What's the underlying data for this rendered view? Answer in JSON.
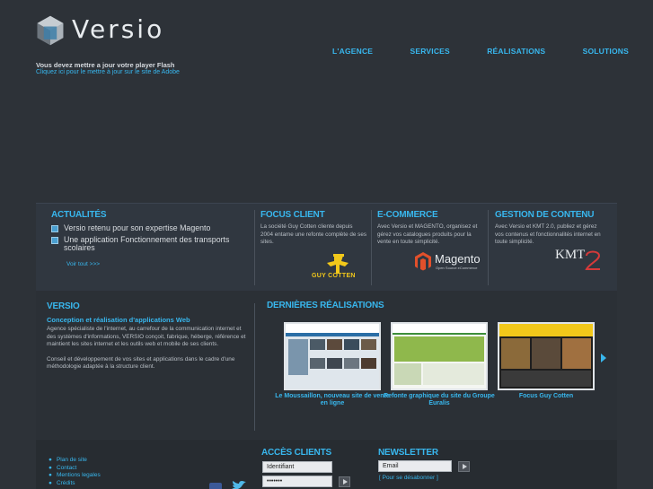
{
  "brand": {
    "name": "Versio"
  },
  "nav": [
    "L'AGENCE",
    "SERVICES",
    "RÉALISATIONS",
    "SOLUTIONS"
  ],
  "flash": {
    "title": "Vous devez mettre a jour votre player Flash",
    "link": "Cliquez ici pour le mettre à jour sur le site de Adobe"
  },
  "actualites": {
    "title": "ACTUALITÉS",
    "items": [
      "Versio retenu pour son expertise Magento",
      "Une application Fonctionnement des transports scolaires"
    ],
    "more": "Voir tout >>>"
  },
  "focus": {
    "title": "FOCUS CLIENT",
    "text": "La société Guy Cotten cliente depuis 2004 entame une refonte complète de ses sites.",
    "logo": "GUY COTTEN"
  },
  "ecommerce": {
    "title": "E-COMMERCE",
    "text": "Avec Versio et MAGENTO, organisez et gérez vos catalogues produits pour la vente en toute simplicité.",
    "logo": "Magento",
    "logo_sub": "Open Source eCommerce"
  },
  "gestion": {
    "title": "GESTION DE CONTENU",
    "text": "Avec Versio et KMT 2.0, publiez et gérez vos contenus et fonctionnalités internet en toute simplicité.",
    "logo": "KMT"
  },
  "versio": {
    "title": "VERSIO",
    "subtitle": "Conception et réalisation d'applications Web",
    "p1": "Agence spécialiste de l'internet, au carrefour de la communication internet et des systèmes d'informations, VERSIO conçoit, fabrique, héberge, référence et maintient les sites internet et les outils web et mobile de ses clients.",
    "p2": "Conseil et développement de vos sites et applications dans le cadre d'une méthodologie adaptée à la structure client."
  },
  "realisations": {
    "title": "DERNIÈRES RÉALISATIONS",
    "items": [
      {
        "caption": "Le Moussaillon, nouveau site de vente en ligne"
      },
      {
        "caption": "Refonte graphique du site du Groupe Euralis"
      },
      {
        "caption": "Focus Guy Cotten"
      }
    ]
  },
  "footer": {
    "links": [
      "Plan de site",
      "Contact",
      "Mentions legales",
      "Crédits"
    ],
    "acces": {
      "title": "ACCÈS CLIENTS",
      "login_value": "Identifiant",
      "password_value": "•••••••"
    },
    "newsletter": {
      "title": "NEWSLETTER",
      "email_value": "Email",
      "unsubscribe": "[ Pour se désabonner ]"
    }
  },
  "colors": {
    "background": "#2d3238",
    "accent": "#38b7ee"
  }
}
